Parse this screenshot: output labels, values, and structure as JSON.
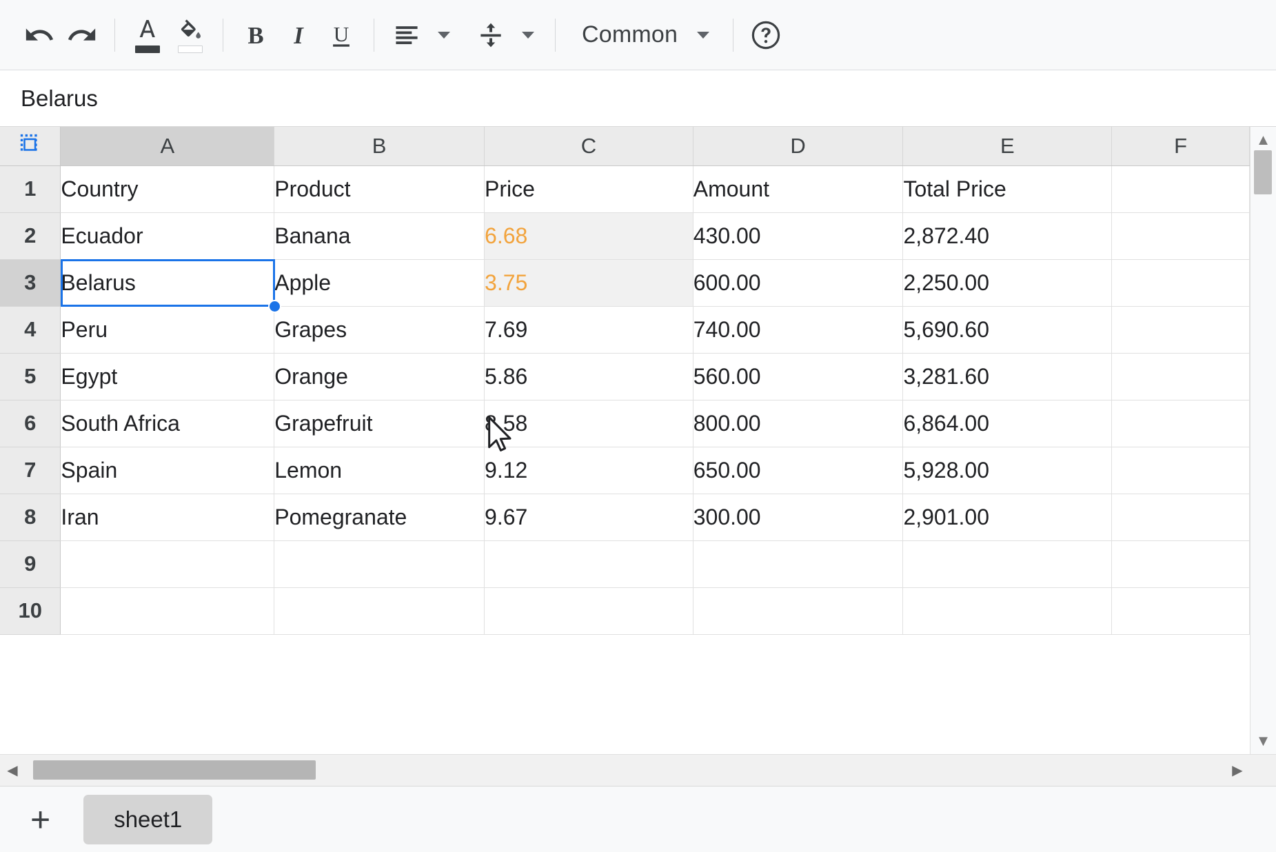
{
  "toolbar": {
    "buttons": [
      {
        "name": "undo",
        "icon": "undo-icon",
        "label": "Undo"
      },
      {
        "name": "redo",
        "icon": "redo-icon",
        "label": "Redo"
      },
      {
        "name": "text-color",
        "icon": "text-color-icon",
        "label": "Text color",
        "swatch": "#3c4043"
      },
      {
        "name": "fill-color",
        "icon": "fill-color-icon",
        "label": "Fill color",
        "swatch": "#ffffff"
      },
      {
        "name": "bold",
        "icon": "bold-icon",
        "label": "B"
      },
      {
        "name": "italic",
        "icon": "italic-icon",
        "label": "I"
      },
      {
        "name": "underline",
        "icon": "underline-icon",
        "label": "U"
      },
      {
        "name": "horizontal-align",
        "icon": "align-left-icon",
        "label": "Horizontal align"
      },
      {
        "name": "vertical-align",
        "icon": "vertical-align-icon",
        "label": "Vertical align"
      },
      {
        "name": "help",
        "icon": "help-circle-icon",
        "label": "Help"
      }
    ],
    "number_format": {
      "value": "Common",
      "caret": "chevron-down-icon"
    }
  },
  "formula_bar": {
    "value": "Belarus",
    "placeholder": ""
  },
  "grid": {
    "select_all_icon": "select-all-icon",
    "columns": [
      "A",
      "B",
      "C",
      "D",
      "E",
      "F"
    ],
    "active_column": "A",
    "row_numbers": [
      "1",
      "2",
      "3",
      "4",
      "5",
      "6",
      "7",
      "8",
      "9",
      "10"
    ],
    "active_row": "3",
    "rows": [
      {
        "cells": [
          "Country",
          "Product",
          "Price",
          "Amount",
          "Total Price",
          ""
        ]
      },
      {
        "cells": [
          "Ecuador",
          "Banana",
          "6.68",
          "430.00",
          "2,872.40",
          ""
        ]
      },
      {
        "cells": [
          "Belarus",
          "Apple",
          "3.75",
          "600.00",
          "2,250.00",
          ""
        ]
      },
      {
        "cells": [
          "Peru",
          "Grapes",
          "7.69",
          "740.00",
          "5,690.60",
          ""
        ]
      },
      {
        "cells": [
          "Egypt",
          "Orange",
          "5.86",
          "560.00",
          "3,281.60",
          ""
        ]
      },
      {
        "cells": [
          "South Africa",
          "Grapefruit",
          "8.58",
          "800.00",
          "6,864.00",
          ""
        ]
      },
      {
        "cells": [
          "Spain",
          "Lemon",
          "9.12",
          "650.00",
          "5,928.00",
          ""
        ]
      },
      {
        "cells": [
          "Iran",
          "Pomegranate",
          "9.67",
          "300.00",
          "2,901.00",
          ""
        ]
      },
      {
        "cells": [
          "",
          "",
          "",
          "",
          "",
          ""
        ]
      },
      {
        "cells": [
          "",
          "",
          "",
          "",
          "",
          ""
        ]
      }
    ],
    "selected_cell": "A3",
    "selection_color": "#1a73e8",
    "highlighted_cells": [
      {
        "ref": "C2",
        "background": "#f1f1f1",
        "text_color": "#f2a33c"
      },
      {
        "ref": "C3",
        "background": "#f1f1f1",
        "text_color": "#f2a33c"
      }
    ]
  },
  "scrollbars": {
    "vertical_up_icon": "chevron-up-icon",
    "vertical_down_icon": "chevron-down-icon",
    "horizontal_left_icon": "triangle-left-icon",
    "horizontal_right_icon": "triangle-right-icon"
  },
  "sheet_tabs": {
    "add_label": "+",
    "tabs": [
      {
        "label": "sheet1",
        "active": true
      }
    ]
  }
}
